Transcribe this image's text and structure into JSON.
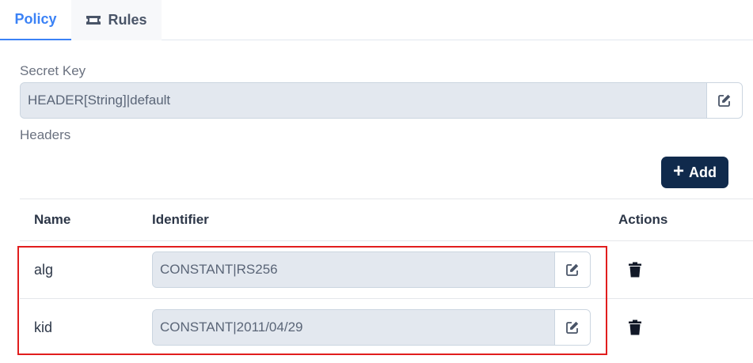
{
  "tabs": [
    {
      "label": "Policy",
      "active": true
    },
    {
      "label": "Rules",
      "icon": "ticket-icon",
      "active": false
    }
  ],
  "secret_key": {
    "label": "Secret Key",
    "value": "HEADER[String]|default",
    "edit_icon": "edit-icon"
  },
  "headers": {
    "label": "Headers",
    "add_button": "Add",
    "columns": [
      "Name",
      "Identifier",
      "Actions"
    ],
    "rows": [
      {
        "name": "alg",
        "identifier": "CONSTANT|RS256"
      },
      {
        "name": "kid",
        "identifier": "CONSTANT|2011/04/29"
      }
    ]
  },
  "colors": {
    "accent": "#3b82f6",
    "primary_button": "#102a4c",
    "highlight": "#e11d1d",
    "input_bg": "#e3e8ef"
  }
}
